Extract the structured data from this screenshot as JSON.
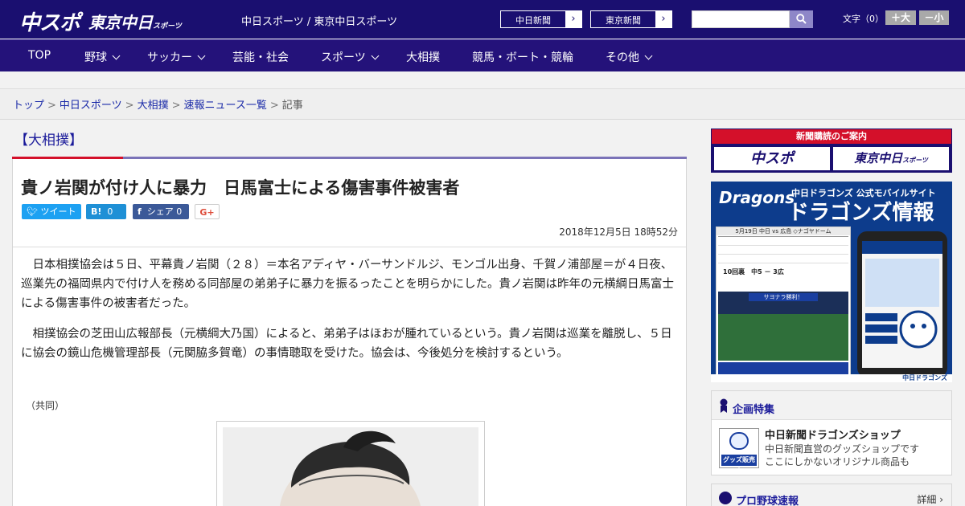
{
  "header": {
    "logo_chunichi": "中スポ",
    "logo_tokyo": "東京中日",
    "logo_tokyo_small": "スポーツ",
    "site_title": "中日スポーツ / 東京中日スポーツ",
    "ext_links": [
      {
        "label": "中日新聞",
        "arrow": "›"
      },
      {
        "label": "東京新聞",
        "arrow": "›"
      }
    ],
    "search": {
      "placeholder": "",
      "value": ""
    },
    "font_size_label": "文字（0）",
    "font_larger": "＋大",
    "font_smaller": "－小"
  },
  "nav": {
    "items": [
      {
        "label": "TOP"
      },
      {
        "label": "野球"
      },
      {
        "label": "サッカー"
      },
      {
        "label": "芸能・社会"
      },
      {
        "label": "スポーツ"
      },
      {
        "label": "大相撲"
      },
      {
        "label": "競馬・ボート・競輪"
      },
      {
        "label": "その他"
      }
    ]
  },
  "breadcrumb": {
    "items": [
      "トップ",
      "中日スポーツ",
      "大相撲",
      "速報ニュース一覧"
    ],
    "separator": ">",
    "current": "記事"
  },
  "article": {
    "category": "【大相撲】",
    "headline": "貴ノ岩関が付け人に暴力　日馬富士による傷害事件被害者",
    "share": {
      "tweet": "ツイート",
      "hatena_icon": "B!",
      "hatena_count": "0",
      "facebook_icon": "f",
      "facebook_label": "シェア",
      "facebook_count": "0",
      "gplus": "G+"
    },
    "datetime": "2018年12月5日 18時52分",
    "paragraphs": [
      "　日本相撲協会は５日、平幕貴ノ岩関（２８）＝本名アディヤ・バーサンドルジ、モンゴル出身、千賀ノ浦部屋＝が４日夜、巡業先の福岡県内で付け人を務める同部屋の弟弟子に暴力を振るったことを明らかにした。貴ノ岩関は昨年の元横綱日馬富士による傷害事件の被害者だった。",
      "　相撲協会の芝田山広報部長（元横綱大乃国）によると、弟弟子はほおが腫れているという。貴ノ岩関は巡業を離脱し、５日に協会の鏡山危機管理部長（元関脇多賀竜）の事情聴取を受けた。協会は、今後処分を検討するという。"
    ],
    "credit": "（共同）"
  },
  "sidebar": {
    "subscribe": {
      "title": "新聞購読のご案内",
      "logo1": "中スポ",
      "logo2": "東京中日",
      "logo2_small": "スポーツ"
    },
    "dragons_ad": {
      "brand": "Dragons",
      "top_line": "中日ドラゴンズ 公式モバイルサイト",
      "title": "ドラゴンズ情報",
      "game_header": "5月19日 中日 vs 広島 ◇ナゴヤドーム",
      "score_line": "10回裏　中5 － 3広",
      "banner": "サヨナラ勝利！",
      "footer": "中日ドラゴンズ"
    },
    "feature": {
      "heading": "企画特集",
      "icon_tag": "グッズ販売中",
      "title": "中日新聞ドラゴンズショップ",
      "desc_line1": "中日新聞直営のグッズショップです",
      "desc_line2": "ここにしかないオリジナル商品も"
    },
    "baseball": {
      "heading": "プロ野球速報",
      "more": "詳細 ›"
    }
  },
  "colors": {
    "header_bg": "#1a0f70",
    "nav_bg": "#24127a",
    "accent_red": "#d4102a",
    "link_blue": "#1a2aa8",
    "twitter": "#1da1f2",
    "hatena": "#1e90d6",
    "facebook": "#3b5998"
  },
  "icons": {
    "search": "search-icon",
    "chevron": "chevron-down-icon",
    "arrow": "arrow-right-icon"
  }
}
